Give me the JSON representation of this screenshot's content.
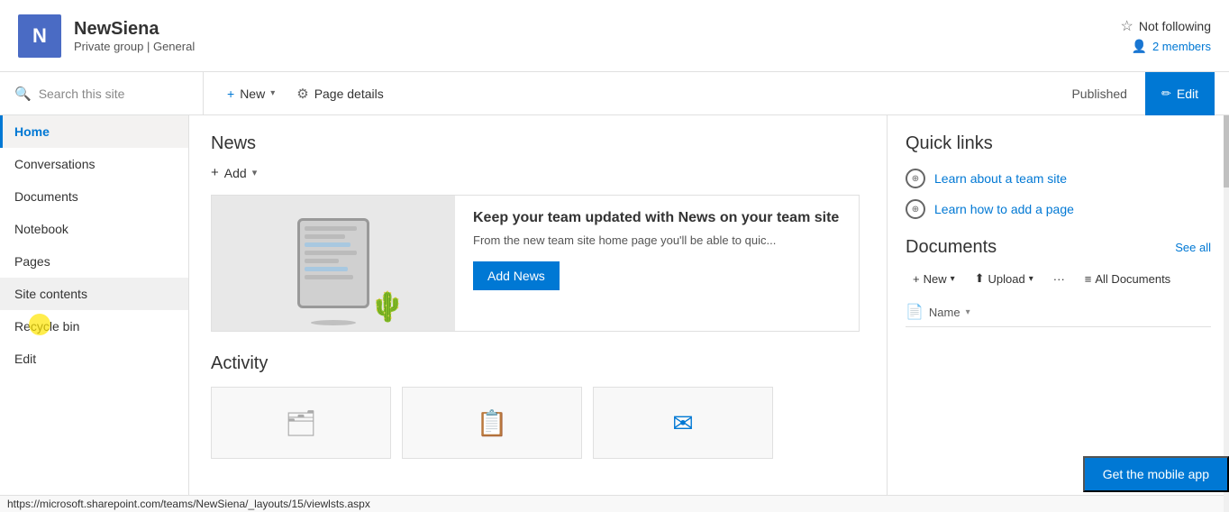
{
  "site": {
    "avatar_letter": "N",
    "name": "NewSiena",
    "group_type": "Private group",
    "separator": "|",
    "general": "General"
  },
  "header": {
    "not_following_label": "Not following",
    "members_label": "2 members"
  },
  "toolbar": {
    "search_placeholder": "Search this site",
    "new_label": "New",
    "page_details_label": "Page details",
    "published_label": "Published",
    "edit_label": "Edit"
  },
  "sidebar": {
    "items": [
      {
        "id": "home",
        "label": "Home",
        "active": true
      },
      {
        "id": "conversations",
        "label": "Conversations",
        "active": false
      },
      {
        "id": "documents",
        "label": "Documents",
        "active": false
      },
      {
        "id": "notebook",
        "label": "Notebook",
        "active": false
      },
      {
        "id": "pages",
        "label": "Pages",
        "active": false
      },
      {
        "id": "site-contents",
        "label": "Site contents",
        "active": false
      },
      {
        "id": "recycle-bin",
        "label": "Recycle bin",
        "active": false
      },
      {
        "id": "edit",
        "label": "Edit",
        "active": false
      }
    ]
  },
  "news": {
    "section_title": "News",
    "add_label": "Add",
    "card": {
      "heading": "Keep your team updated with News on your team site",
      "description": "From the new team site home page you'll be able to quic...",
      "cta_label": "Add News"
    }
  },
  "activity": {
    "section_title": "Activity"
  },
  "quick_links": {
    "section_title": "Quick links",
    "items": [
      {
        "label": "Learn about a team site"
      },
      {
        "label": "Learn how to add a page"
      }
    ]
  },
  "documents": {
    "section_title": "Documents",
    "see_all_label": "See all",
    "toolbar": {
      "new_label": "New",
      "upload_label": "Upload",
      "all_docs_label": "All Documents"
    },
    "column_name": "Name"
  },
  "mobile_app": {
    "label": "Get the mobile app"
  },
  "status_bar": {
    "url": "https://microsoft.sharepoint.com/teams/NewSiena/_layouts/15/viewlsts.aspx"
  }
}
